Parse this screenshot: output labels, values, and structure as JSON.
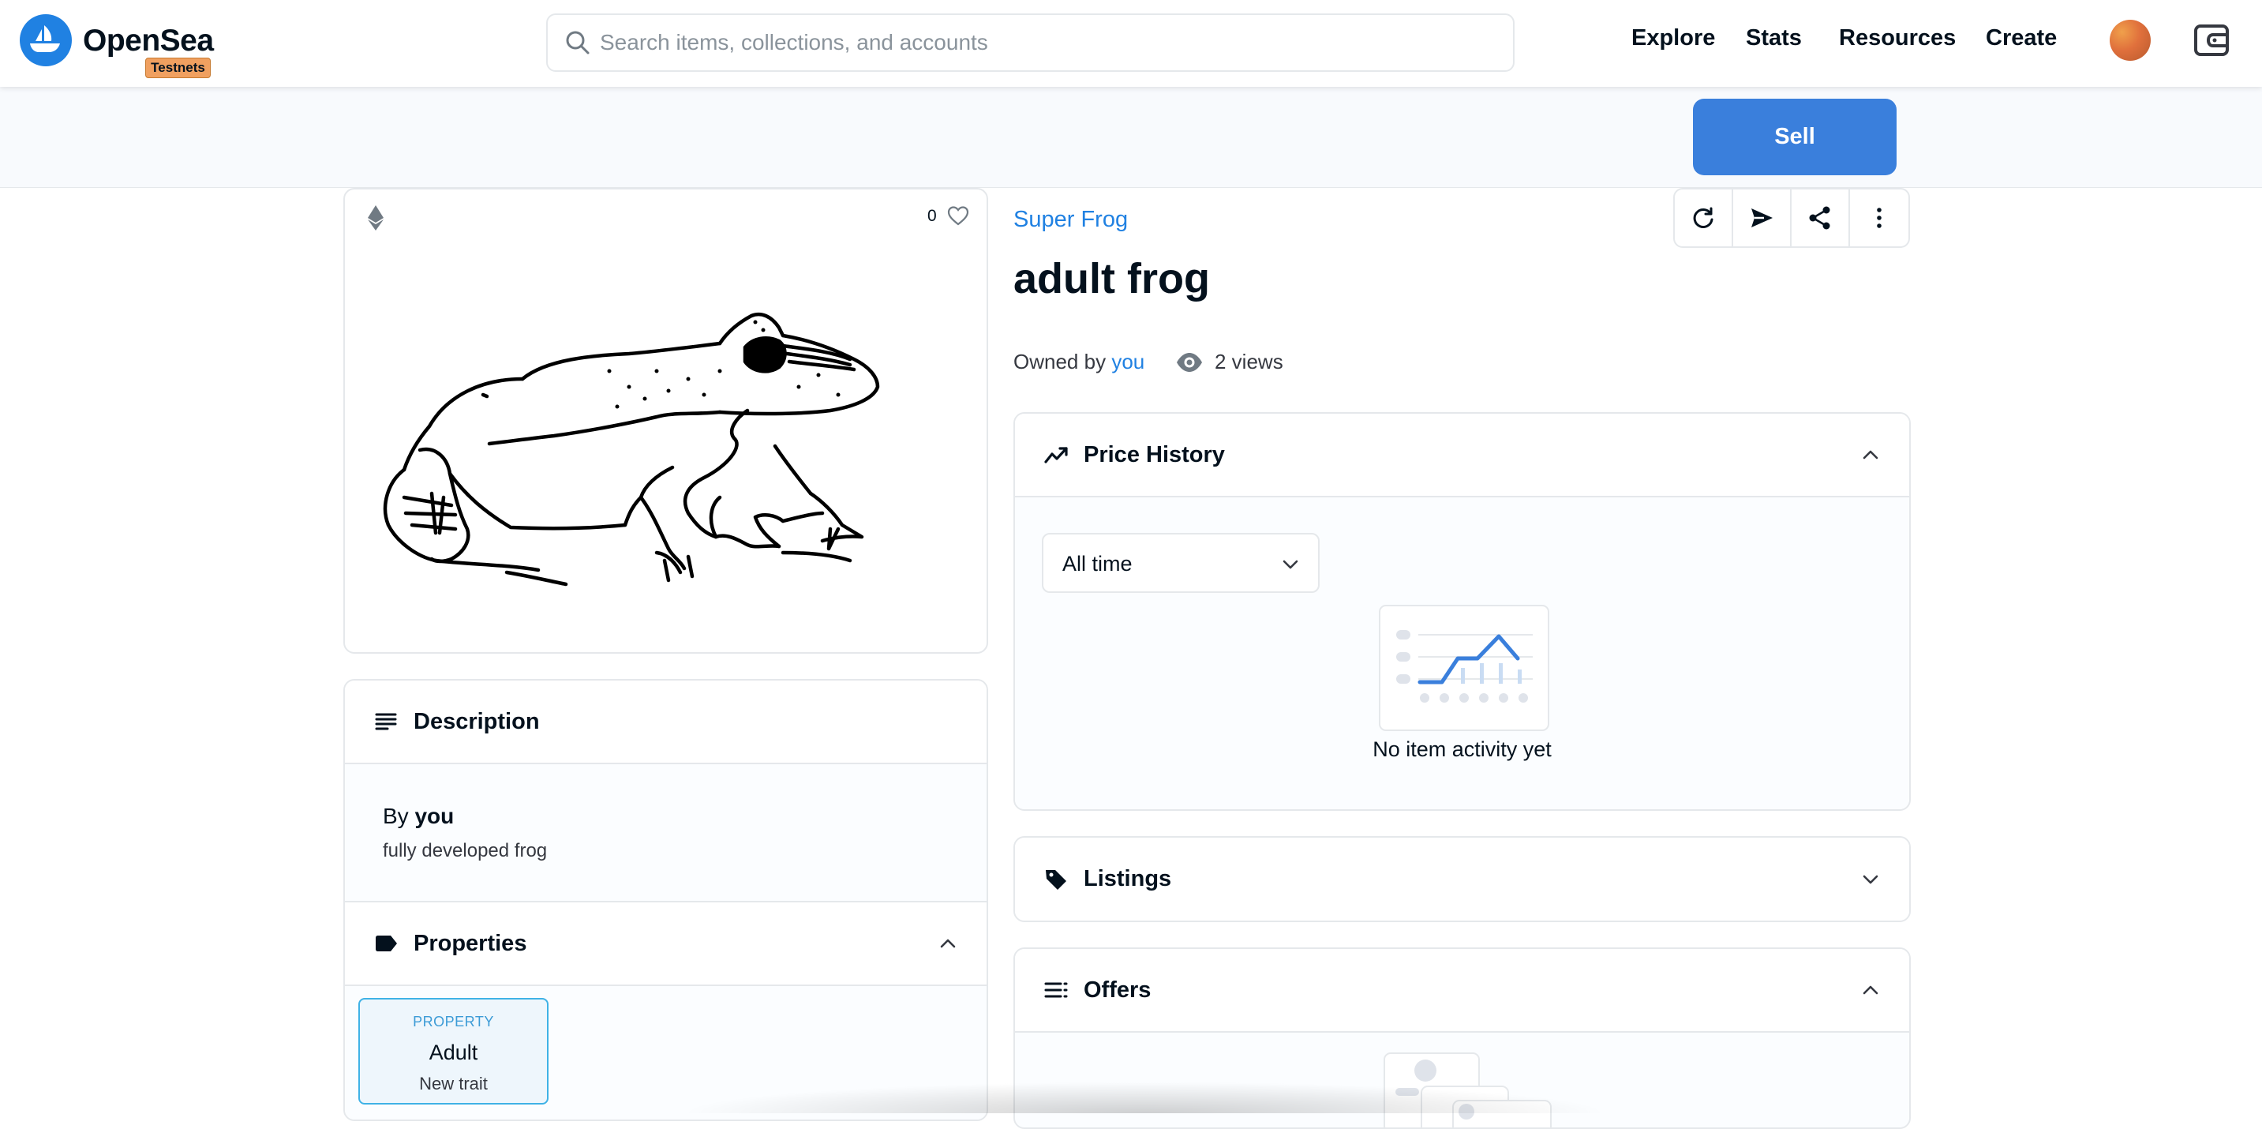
{
  "header": {
    "brand": "OpenSea",
    "badge": "Testnets",
    "search_placeholder": "Search items, collections, and accounts",
    "nav": [
      "Explore",
      "Stats",
      "Resources",
      "Create"
    ]
  },
  "subbar": {
    "sell_label": "Sell"
  },
  "media": {
    "favorites_count": "0"
  },
  "description": {
    "title": "Description",
    "by_prefix": "By",
    "creator": "you",
    "text": "fully developed frog"
  },
  "properties": {
    "title": "Properties",
    "items": [
      {
        "type": "PROPERTY",
        "value": "Adult",
        "rarity": "New trait"
      }
    ]
  },
  "item": {
    "collection": "Super Frog",
    "title": "adult frog",
    "owned_by_prefix": "Owned by",
    "owner": "you",
    "views": "2 views"
  },
  "price_history": {
    "title": "Price History",
    "range": "All time",
    "empty_text": "No item activity yet"
  },
  "listings": {
    "title": "Listings"
  },
  "offers": {
    "title": "Offers"
  },
  "colors": {
    "accent": "#2081e2",
    "sell_button": "#3a7fdc",
    "badge": "#f0a060",
    "border": "#e5e8eb",
    "text": "#04111d"
  }
}
